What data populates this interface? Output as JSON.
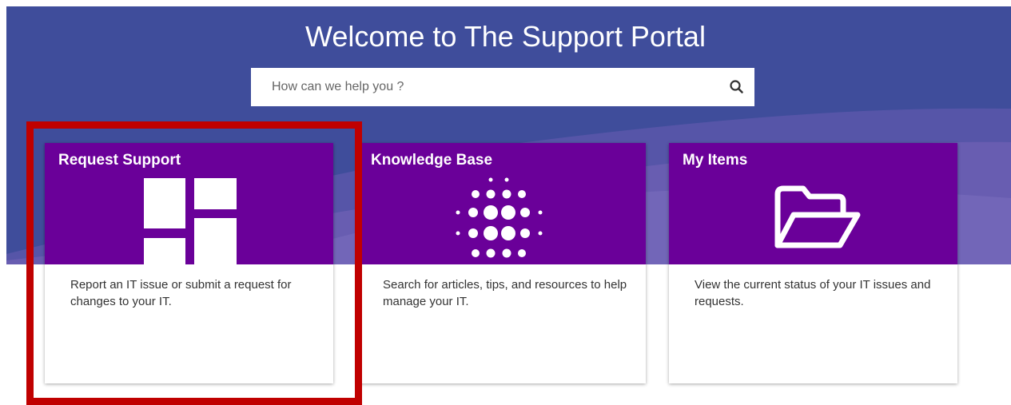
{
  "hero": {
    "title": "Welcome to The Support Portal",
    "search_placeholder": "How can we help you ?",
    "background_color": "#3f4d9b"
  },
  "cards": [
    {
      "title": "Request Support",
      "description": "Report an IT issue or submit a request for changes to your IT.",
      "icon": "request-grid-icon"
    },
    {
      "title": "Knowledge Base",
      "description": "Search for articles, tips, and resources to help manage your IT.",
      "icon": "knowledge-dots-icon"
    },
    {
      "title": "My Items",
      "description": "View the current status of your IT issues and requests.",
      "icon": "folder-open-icon"
    }
  ],
  "colors": {
    "card_header": "#6a0099",
    "highlight": "#c00000"
  }
}
